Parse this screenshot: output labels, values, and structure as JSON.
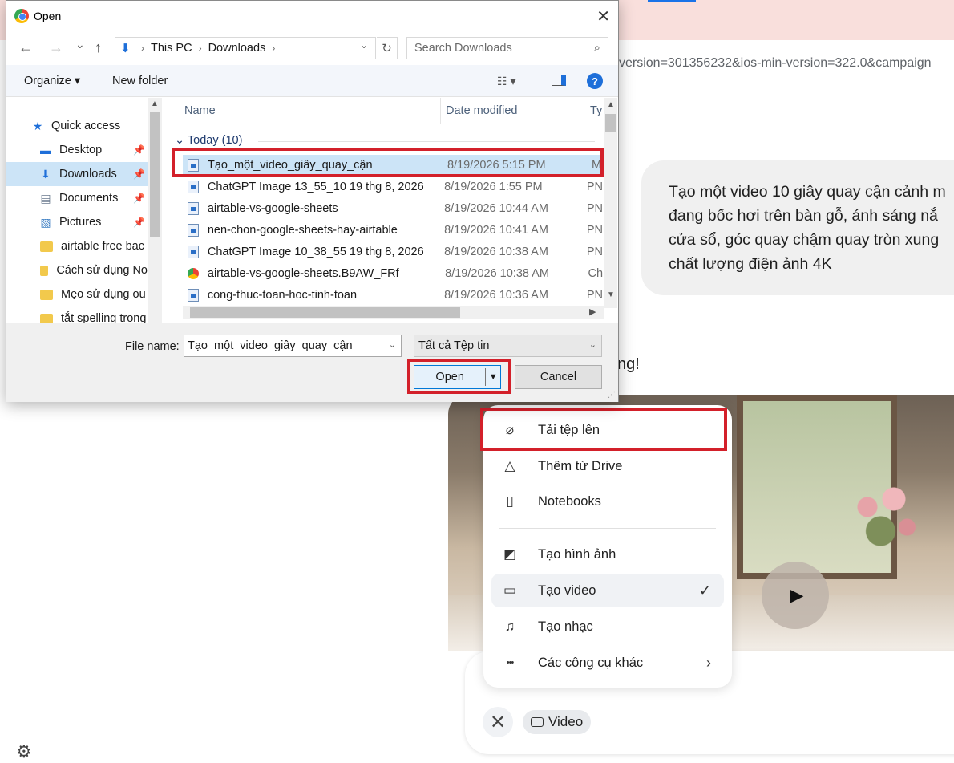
{
  "background": {
    "url_fragment": "version=301356232&ios-min-version=322.0&campaign",
    "prompt_lines": [
      "Tạo một video 10 giây quay cận cảnh m",
      "đang bốc hơi trên bàn gỗ, ánh sáng nắ",
      "cửa sổ, góc quay chậm quay tròn xung",
      "chất lượng điện ảnh 4K"
    ],
    "reply_fragment": "ng!",
    "play_glyph": "▶",
    "composer": {
      "close_glyph": "✕",
      "chip_label": "Video"
    },
    "settings_glyph": "⚙"
  },
  "tools_menu": {
    "items": [
      {
        "label": "Tải tệp lên",
        "icon": "paperclip-icon",
        "glyph": "⌀"
      },
      {
        "label": "Thêm từ Drive",
        "icon": "drive-icon",
        "glyph": "△"
      },
      {
        "label": "Notebooks",
        "icon": "notebook-icon",
        "glyph": "▯"
      },
      {
        "label": "Tạo hình ảnh",
        "icon": "image-icon",
        "glyph": "◩"
      },
      {
        "label": "Tạo video",
        "icon": "video-icon",
        "glyph": "▭",
        "check": "✓"
      },
      {
        "label": "Tạo nhạc",
        "icon": "music-icon",
        "glyph": "♫"
      },
      {
        "label": "Các công cụ khác",
        "icon": "more-icon",
        "glyph": "•••",
        "chevron": "›"
      }
    ],
    "highlight_color": "#d3202a"
  },
  "dialog": {
    "title": "Open",
    "close_glyph": "✕",
    "nav": {
      "back": "←",
      "forward": "→",
      "recent": "⌄",
      "up": "↑"
    },
    "address": {
      "crumbs": [
        "This PC",
        "Downloads"
      ],
      "sep": "›",
      "drop": "⌄",
      "refresh": "↻"
    },
    "search_placeholder": "Search Downloads",
    "search_glyph": "⌕",
    "commands": {
      "organize": "Organize ▾",
      "new_folder": "New folder",
      "view": "☷ ▾",
      "help": "?"
    },
    "nav_pane": {
      "quick_access": "Quick access",
      "items": [
        {
          "label": "Desktop",
          "pinned": true
        },
        {
          "label": "Downloads",
          "pinned": true,
          "selected": true
        },
        {
          "label": "Documents",
          "pinned": true
        },
        {
          "label": "Pictures",
          "pinned": true
        },
        {
          "label": "airtable free bac",
          "pinned": false
        },
        {
          "label": "Cách sử dụng No",
          "pinned": false
        },
        {
          "label": "Mẹo sử dụng ou",
          "pinned": false
        },
        {
          "label": "tắt spelling trong",
          "pinned": false
        }
      ],
      "pin_glyph": "📌"
    },
    "columns": [
      "Name",
      "Date modified",
      "Ty"
    ],
    "group_header": "Today (10)",
    "files": [
      {
        "name": "Tạo_một_video_giây_quay_cận",
        "date": "8/19/2026 5:15 PM",
        "type": "M",
        "selected": true
      },
      {
        "name": "ChatGPT Image 13_55_10 19 thg 8, 2026",
        "date": "8/19/2026 1:55 PM",
        "type": "PN"
      },
      {
        "name": "airtable-vs-google-sheets",
        "date": "8/19/2026 10:44 AM",
        "type": "PN"
      },
      {
        "name": "nen-chon-google-sheets-hay-airtable",
        "date": "8/19/2026 10:41 AM",
        "type": "PN"
      },
      {
        "name": "ChatGPT Image 10_38_55 19 thg 8, 2026",
        "date": "8/19/2026 10:38 AM",
        "type": "PN"
      },
      {
        "name": "airtable-vs-google-sheets.B9AW_FRf",
        "date": "8/19/2026 10:38 AM",
        "type": "Ch",
        "chrome": true
      },
      {
        "name": "cong-thuc-toan-hoc-tinh-toan",
        "date": "8/19/2026 10:36 AM",
        "type": "PN"
      }
    ],
    "file_name_label": "File name:",
    "file_name_value": "Tạo_một_video_giây_quay_cận",
    "file_type": "Tất cả Tệp tin",
    "open_label": "Open",
    "cancel_label": "Cancel",
    "dropdown_glyph": "⌄",
    "split_arrow": "▼"
  }
}
